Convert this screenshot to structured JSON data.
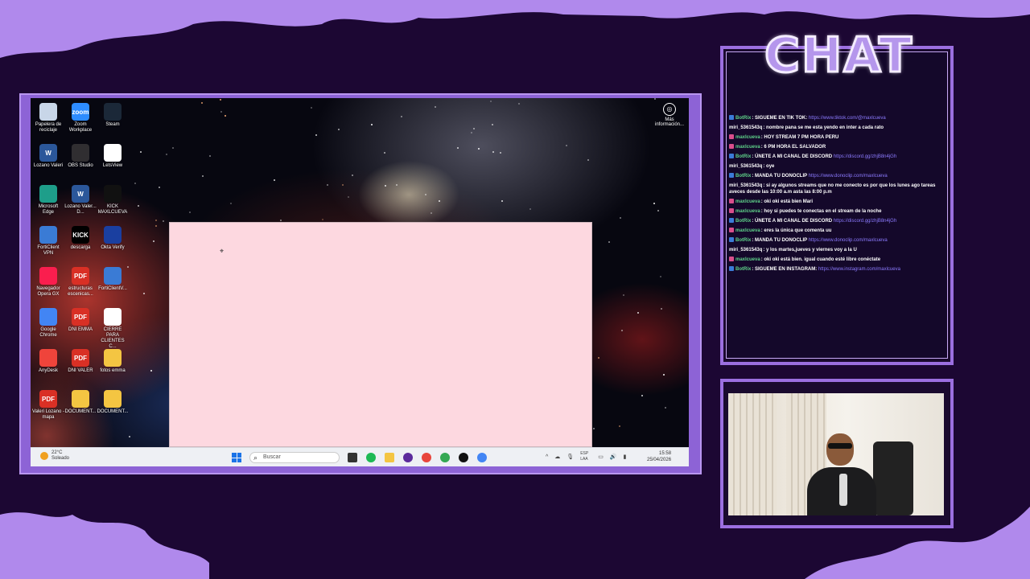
{
  "desktop": {
    "icons": [
      {
        "label": "Papelera de reciclaje",
        "icon": "recycle-bin-icon",
        "color": "#c8d6e8"
      },
      {
        "label": "Zoom Workplace",
        "icon": "zoom-icon",
        "color": "#2d8cff",
        "glyph": "zoom"
      },
      {
        "label": "Steam",
        "icon": "steam-icon",
        "color": "#1b2838"
      },
      {
        "label": "Lozano Valeri",
        "icon": "word-doc-icon",
        "color": "#2b579a",
        "glyph": "W"
      },
      {
        "label": "OBS Studio",
        "icon": "obs-icon",
        "color": "#302e31"
      },
      {
        "label": "LetsView",
        "icon": "letsview-icon",
        "color": "#ffffff"
      },
      {
        "label": "Microsoft Edge",
        "icon": "edge-icon",
        "color": "#1e9e8a"
      },
      {
        "label": "Lozano Valer... D...",
        "icon": "word-doc-icon",
        "color": "#2b579a",
        "glyph": "W"
      },
      {
        "label": "KICK MAXLCUEVA",
        "icon": "kick-icon",
        "color": "#111111"
      },
      {
        "label": "FortiClient VPN",
        "icon": "forticlient-icon",
        "color": "#3a7bd5"
      },
      {
        "label": "descarga",
        "icon": "kick-image-icon",
        "color": "#000000",
        "glyph": "KICK"
      },
      {
        "label": "Okta Verify",
        "icon": "okta-icon",
        "color": "#1a3fa0"
      },
      {
        "label": "Navegador Opera GX",
        "icon": "opera-gx-icon",
        "color": "#fa1e4e"
      },
      {
        "label": "estructuras escenicas...",
        "icon": "pdf-icon",
        "color": "#d93025",
        "glyph": "PDF"
      },
      {
        "label": "FortiClientV...",
        "icon": "forticlient-icon",
        "color": "#3a7bd5"
      },
      {
        "label": "Google Chrome",
        "icon": "chrome-icon",
        "color": "#4285f4"
      },
      {
        "label": "DNI EMMA",
        "icon": "pdf-icon",
        "color": "#d93025",
        "glyph": "PDF"
      },
      {
        "label": "CIERRE PARA CLIENTES C...",
        "icon": "blank-file-icon",
        "color": "#ffffff"
      },
      {
        "label": "AnyDesk",
        "icon": "anydesk-icon",
        "color": "#ef443b"
      },
      {
        "label": "DNI VALER",
        "icon": "pdf-icon",
        "color": "#d93025",
        "glyph": "PDF"
      },
      {
        "label": "fotos emma",
        "icon": "folder-icon",
        "color": "#f4c542"
      },
      {
        "label": "Valeri Lozano - mapa",
        "icon": "pdf-icon",
        "color": "#d93025",
        "glyph": "PDF"
      },
      {
        "label": "DOCUMENT...",
        "icon": "folder-icon",
        "color": "#f4c542"
      },
      {
        "label": "DOCUMENT...",
        "icon": "folder-icon",
        "color": "#f4c542"
      }
    ],
    "mas_info": "Más información..."
  },
  "taskbar": {
    "weather_temp": "22°C",
    "weather_desc": "Soleado",
    "search_placeholder": "Buscar",
    "lang": "ESP LAA",
    "time": "15:58",
    "date": "25/04/2026"
  },
  "chat": {
    "title": "CHAT",
    "messages": [
      {
        "user": "BotRix",
        "bot": true,
        "text": ": SIGUEME EN TIK TOK: ",
        "link": "https://www.tiktok.com/@maxlcueva"
      },
      {
        "user": "miri_5361543q",
        "bot": false,
        "text": ": nombre pana se me esta yendo en inter a cada rato",
        "link": ""
      },
      {
        "user": "maxlcueva",
        "bot": false,
        "host": true,
        "text": ": HOY STREAM 7 PM HORA PERU",
        "link": ""
      },
      {
        "user": "maxlcueva",
        "bot": false,
        "host": true,
        "text": ": 6 PM HORA EL SALVADOR",
        "link": ""
      },
      {
        "user": "BotRix",
        "bot": true,
        "text": ": ÚNETE A MI CANAL DE DISCORD ",
        "link": "https://discord.gg/zhjB8n4jGh"
      },
      {
        "user": "miri_5361543q",
        "bot": false,
        "text": ": oye",
        "link": ""
      },
      {
        "user": "BotRix",
        "bot": true,
        "text": ": MANDA TU DONOCLIP ",
        "link": "https://www.donoclip.com/maxlcueva"
      },
      {
        "user": "miri_5361543q",
        "bot": false,
        "text": ": si ay algunos streams que no me conecto es por que los lunes ago tareas aveces desde las 10:00 a.m asta las 8:00 p.m",
        "link": ""
      },
      {
        "user": "maxlcueva",
        "bot": false,
        "host": true,
        "text": ": oki oki está bien Mari",
        "link": ""
      },
      {
        "user": "maxlcueva",
        "bot": false,
        "host": true,
        "text": ": hoy si puedes te conectas en el stream de la noche",
        "link": ""
      },
      {
        "user": "BotRix",
        "bot": true,
        "text": ": ÚNETE A MI CANAL DE DISCORD ",
        "link": "https://discord.gg/zhjB8n4jGh"
      },
      {
        "user": "maxlcueva",
        "bot": false,
        "host": true,
        "text": ": eres la única que comenta uu",
        "link": ""
      },
      {
        "user": "BotRix",
        "bot": true,
        "text": ": MANDA TU DONOCLIP ",
        "link": "https://www.donoclip.com/maxlcueva"
      },
      {
        "user": "miri_5361543q",
        "bot": false,
        "text": ": y los martes,jueves y viernes voy a la U",
        "link": ""
      },
      {
        "user": "maxlcueva",
        "bot": false,
        "host": true,
        "text": ": oki oki está bien. igual cuando esté libre conéctate",
        "link": ""
      },
      {
        "user": "BotRix",
        "bot": true,
        "text": ": SIGUEME EN INSTAGRAM: ",
        "link": "https://www.instagram.com/maxlcueva"
      }
    ]
  },
  "colors": {
    "background": "#1c0733",
    "accent": "#9b6fe0",
    "bot_name": "#5fd38a",
    "host_name": "#5fd38a",
    "viewer_name": "#ffffff",
    "link": "#8c7bff"
  }
}
